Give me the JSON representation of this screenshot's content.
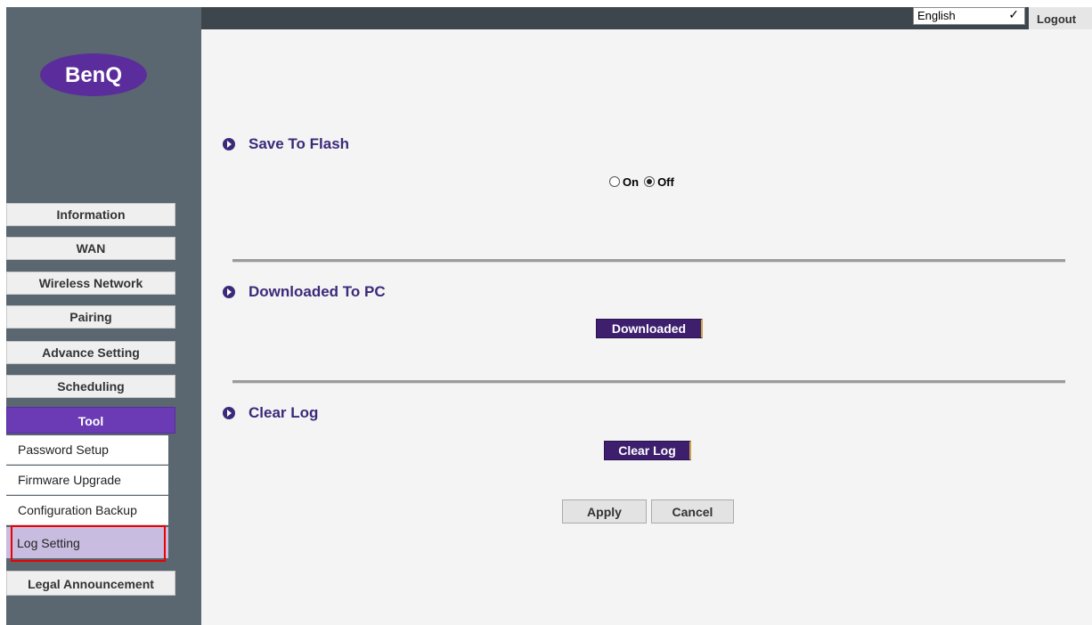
{
  "header": {
    "language": "English",
    "logout_label": "Logout"
  },
  "brand": {
    "logo_text": "BenQ",
    "logo_color": "#5b2d9c"
  },
  "sidebar": {
    "items": [
      {
        "label": "Information"
      },
      {
        "label": "WAN"
      },
      {
        "label": "Wireless Network"
      },
      {
        "label": "Pairing"
      },
      {
        "label": "Advance Setting"
      },
      {
        "label": "Scheduling"
      },
      {
        "label": "Tool"
      },
      {
        "label": "Legal Announcement"
      }
    ],
    "tool_submenu": [
      {
        "label": "Password Setup"
      },
      {
        "label": "Firmware Upgrade"
      },
      {
        "label": "Configuration Backup"
      },
      {
        "label": "Log Setting"
      }
    ],
    "active_item": "Tool",
    "selected_sub": "Log Setting"
  },
  "main": {
    "save_to_flash": {
      "title": "Save To Flash",
      "options": [
        {
          "label": "On",
          "checked": false
        },
        {
          "label": "Off",
          "checked": true
        }
      ]
    },
    "downloaded_to_pc": {
      "title": "Downloaded To PC",
      "button_label": "Downloaded"
    },
    "clear_log": {
      "title": "Clear Log",
      "button_label": "Clear Log"
    },
    "apply_label": "Apply",
    "cancel_label": "Cancel"
  },
  "colors": {
    "accent": "#6a3bb4",
    "title": "#3b2a7a",
    "highlight_border": "#e00000"
  }
}
